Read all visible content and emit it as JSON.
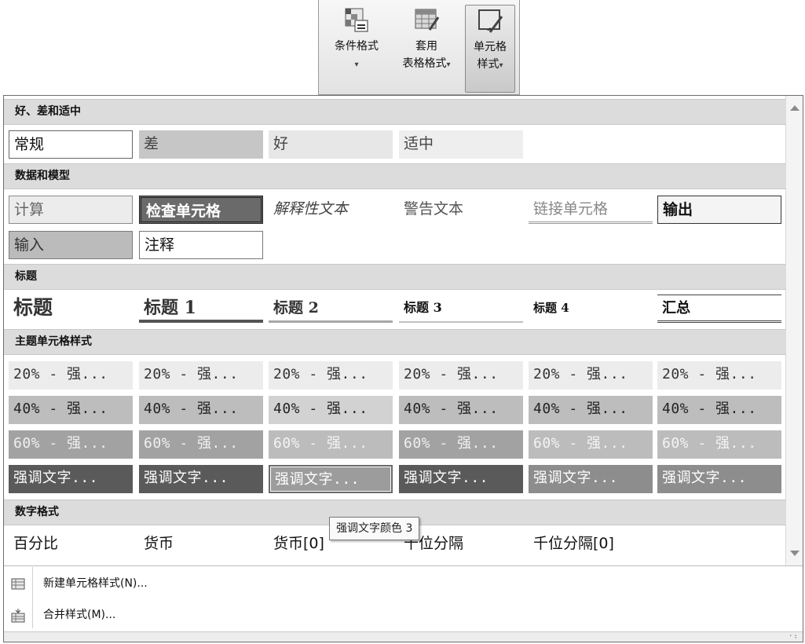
{
  "ribbon": {
    "conditional": {
      "label": "条件格式",
      "dropdown": "▾"
    },
    "table": {
      "label_line1": "套用",
      "label_line2": "表格格式",
      "dropdown": "▾"
    },
    "cellstyle": {
      "label_line1": "单元格",
      "label_line2": "样式",
      "dropdown": "▾"
    }
  },
  "sections": {
    "good_bad": "好、差和适中",
    "data_model": "数据和模型",
    "titles": "标题",
    "themed": "主题单元格样式",
    "number": "数字格式"
  },
  "good_bad": [
    "常规",
    "差",
    "好",
    "适中"
  ],
  "data_model": {
    "row1": [
      "计算",
      "检查单元格",
      "解释性文本",
      "警告文本",
      "链接单元格",
      "输出"
    ],
    "row2": [
      "输入",
      "注释"
    ]
  },
  "titles": [
    "标题",
    "标题 1",
    "标题 2",
    "标题 3",
    "标题 4",
    "汇总"
  ],
  "themed": {
    "row20": [
      "20% - 强...",
      "20% - 强...",
      "20% - 强...",
      "20% - 强...",
      "20% - 强...",
      "20% - 强..."
    ],
    "row40": [
      "40% - 强...",
      "40% - 强...",
      "40% - 强...",
      "40% - 强...",
      "40% - 强...",
      "40% - 强..."
    ],
    "row60": [
      "60% - 强...",
      "60% - 强...",
      "60% - 强...",
      "60% - 强...",
      "60% - 强...",
      "60% - 强..."
    ],
    "accent": [
      "强调文字...",
      "强调文字...",
      "强调文字...",
      "强调文字...",
      "强调文字...",
      "强调文字..."
    ]
  },
  "number": [
    "百分比",
    "货币",
    "货币[0]",
    "千位分隔",
    "千位分隔[0]"
  ],
  "tooltip": "强调文字颜色 3",
  "menu": {
    "new_style": "新建单元格样式(N)...",
    "merge_styles": "合并样式(M)..."
  },
  "colors": {
    "section_bg": "#dcdcdc",
    "accent_dark": "#5a5a5a",
    "panel_border": "#6e6e6e"
  }
}
